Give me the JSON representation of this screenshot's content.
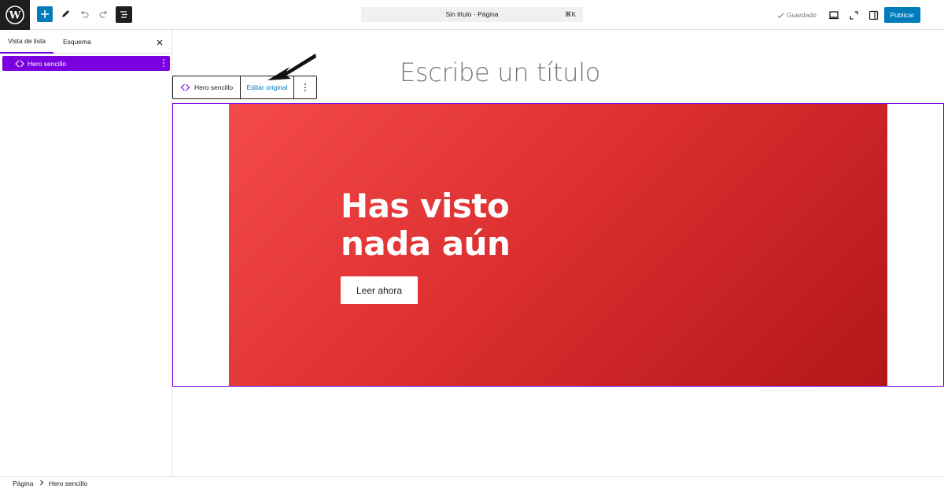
{
  "topbar": {
    "document_title": "Sin título · Página",
    "shortcut": "⌘K",
    "saved_label": "Guardado",
    "publish_label": "Publicar"
  },
  "sidebar": {
    "tabs": [
      {
        "label": "Vista de lista",
        "active": true
      },
      {
        "label": "Esquema",
        "active": false
      }
    ],
    "items": [
      {
        "label": "Hero sencillo",
        "selected": true,
        "icon": "pattern-diamond-icon"
      }
    ]
  },
  "editor": {
    "title_placeholder": "Escribe un título",
    "block_toolbar": {
      "block_label": "Hero sencillo",
      "edit_original_label": "Editar original"
    },
    "hero": {
      "heading_line1": "Has visto",
      "heading_line2": "nada aún",
      "button_label": "Leer ahora"
    }
  },
  "breadcrumb": {
    "items": [
      "Página",
      "Hero sencillo"
    ]
  },
  "colors": {
    "accent": "#7a00df",
    "primary": "#007cba",
    "hero_start": "#f54a4a",
    "hero_end": "#b3161a"
  }
}
